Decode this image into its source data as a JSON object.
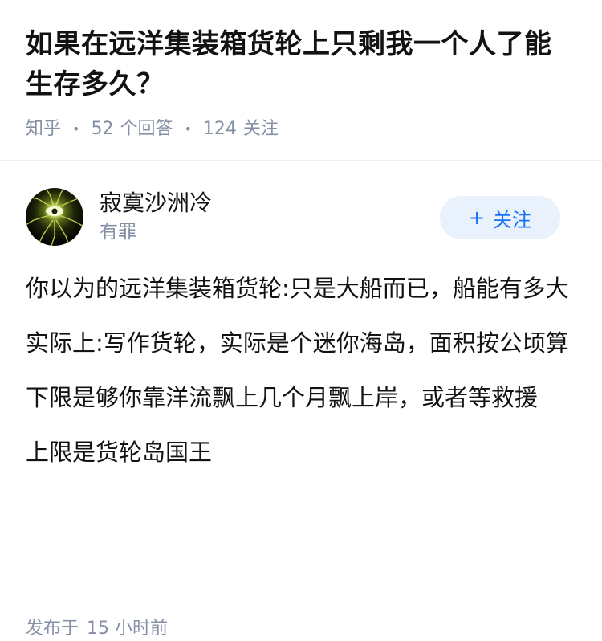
{
  "question": {
    "title": "如果在远洋集装箱货轮上只剩我一个人了能生存多久？",
    "source": "知乎",
    "answer_count": "52",
    "answer_label": "个回答",
    "follower_count": "124",
    "follower_label": "关注"
  },
  "answer": {
    "author": {
      "name": "寂寞沙洲冷",
      "headline": "有罪",
      "avatar_icon": "glowing-eye-avatar"
    },
    "follow_button": {
      "icon": "plus-icon",
      "label": "关注"
    },
    "paragraphs": [
      "你以为的远洋集装箱货轮:只是大船而已，船能有多大",
      "实际上:写作货轮，实际是个迷你海岛，面积按公顷算",
      "下限是够你靠洋流飘上几个月飘上岸，或者等救援",
      "上限是货轮岛国王"
    ],
    "published_label": "发布于",
    "published_time": "15 小时前"
  },
  "colors": {
    "primary_text": "#121212",
    "meta_text": "#8590a6",
    "follow_bg": "#e8f1fc",
    "follow_text": "#1772f6",
    "divider": "#efefef"
  }
}
